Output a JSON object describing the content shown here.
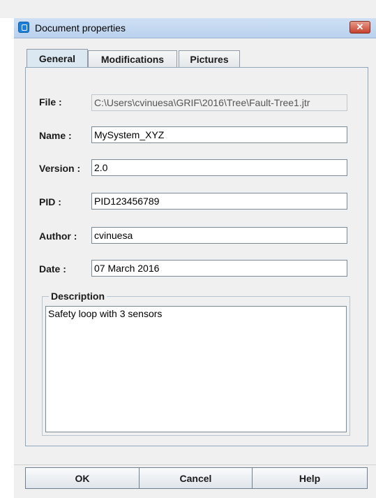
{
  "window": {
    "title": "Document properties",
    "close_glyph": "✕"
  },
  "tabs": [
    {
      "label": "General",
      "active": true
    },
    {
      "label": "Modifications",
      "active": false
    },
    {
      "label": "Pictures",
      "active": false
    }
  ],
  "form": {
    "file": {
      "label": "File :",
      "value": "C:\\Users\\cvinuesa\\GRIF\\2016\\Tree\\Fault-Tree1.jtr"
    },
    "name": {
      "label": "Name :",
      "value": "MySystem_XYZ"
    },
    "version": {
      "label": "Version :",
      "value": "2.0"
    },
    "pid": {
      "label": "PID :",
      "value": "PID123456789"
    },
    "author": {
      "label": "Author :",
      "value": "cvinuesa"
    },
    "date": {
      "label": "Date :",
      "value": "07 March 2016"
    }
  },
  "description": {
    "legend": "Description",
    "value": "Safety loop with 3 sensors"
  },
  "buttons": {
    "ok": "OK",
    "cancel": "Cancel",
    "help": "Help"
  },
  "icons": {
    "app": "document-app-icon",
    "close": "close-icon"
  }
}
